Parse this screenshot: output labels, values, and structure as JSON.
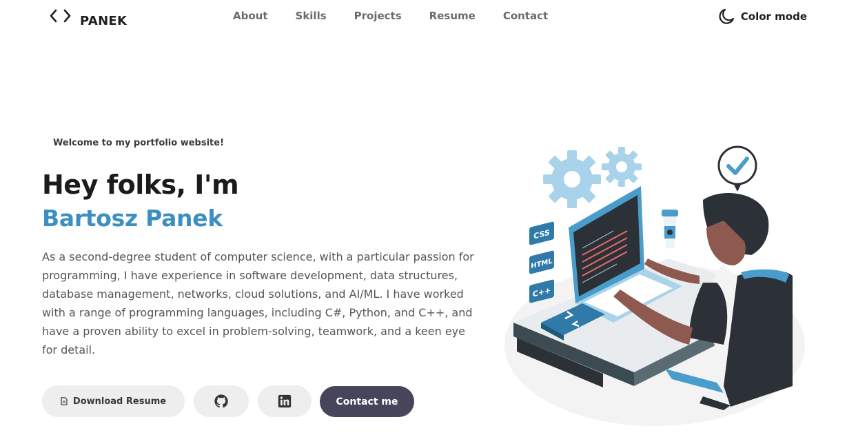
{
  "brand": {
    "logo_text": "PANEK"
  },
  "nav": {
    "links": [
      "About",
      "Skills",
      "Projects",
      "Resume",
      "Contact"
    ],
    "color_mode_label": "Color mode"
  },
  "hero": {
    "welcome": "Welcome to my portfolio website!",
    "greeting": "Hey folks, I'm",
    "name": "Bartosz Panek",
    "bio": "As a second-degree student of computer science, with a particular passion for programming, I have experience in software development, data structures, database management, networks, cloud solutions, and AI/ML. I have worked with a range of programming languages, including C#, Python, and C++, and have a proven ability to excel in problem-solving, teamwork, and a keen eye for detail."
  },
  "actions": {
    "download_resume_label": "Download Resume",
    "github_icon": "github-icon",
    "linkedin_icon": "linkedin-icon",
    "contact_label": "Contact me"
  },
  "illustration": {
    "tags": [
      "CSS",
      "HTML",
      "C++"
    ]
  },
  "colors": {
    "accent": "#3c8fc0",
    "contact_button": "#474559",
    "secondary_button": "#eeeeee",
    "illustration_blue": "#4a9ccb",
    "illustration_light_blue": "#a9d3ea"
  }
}
